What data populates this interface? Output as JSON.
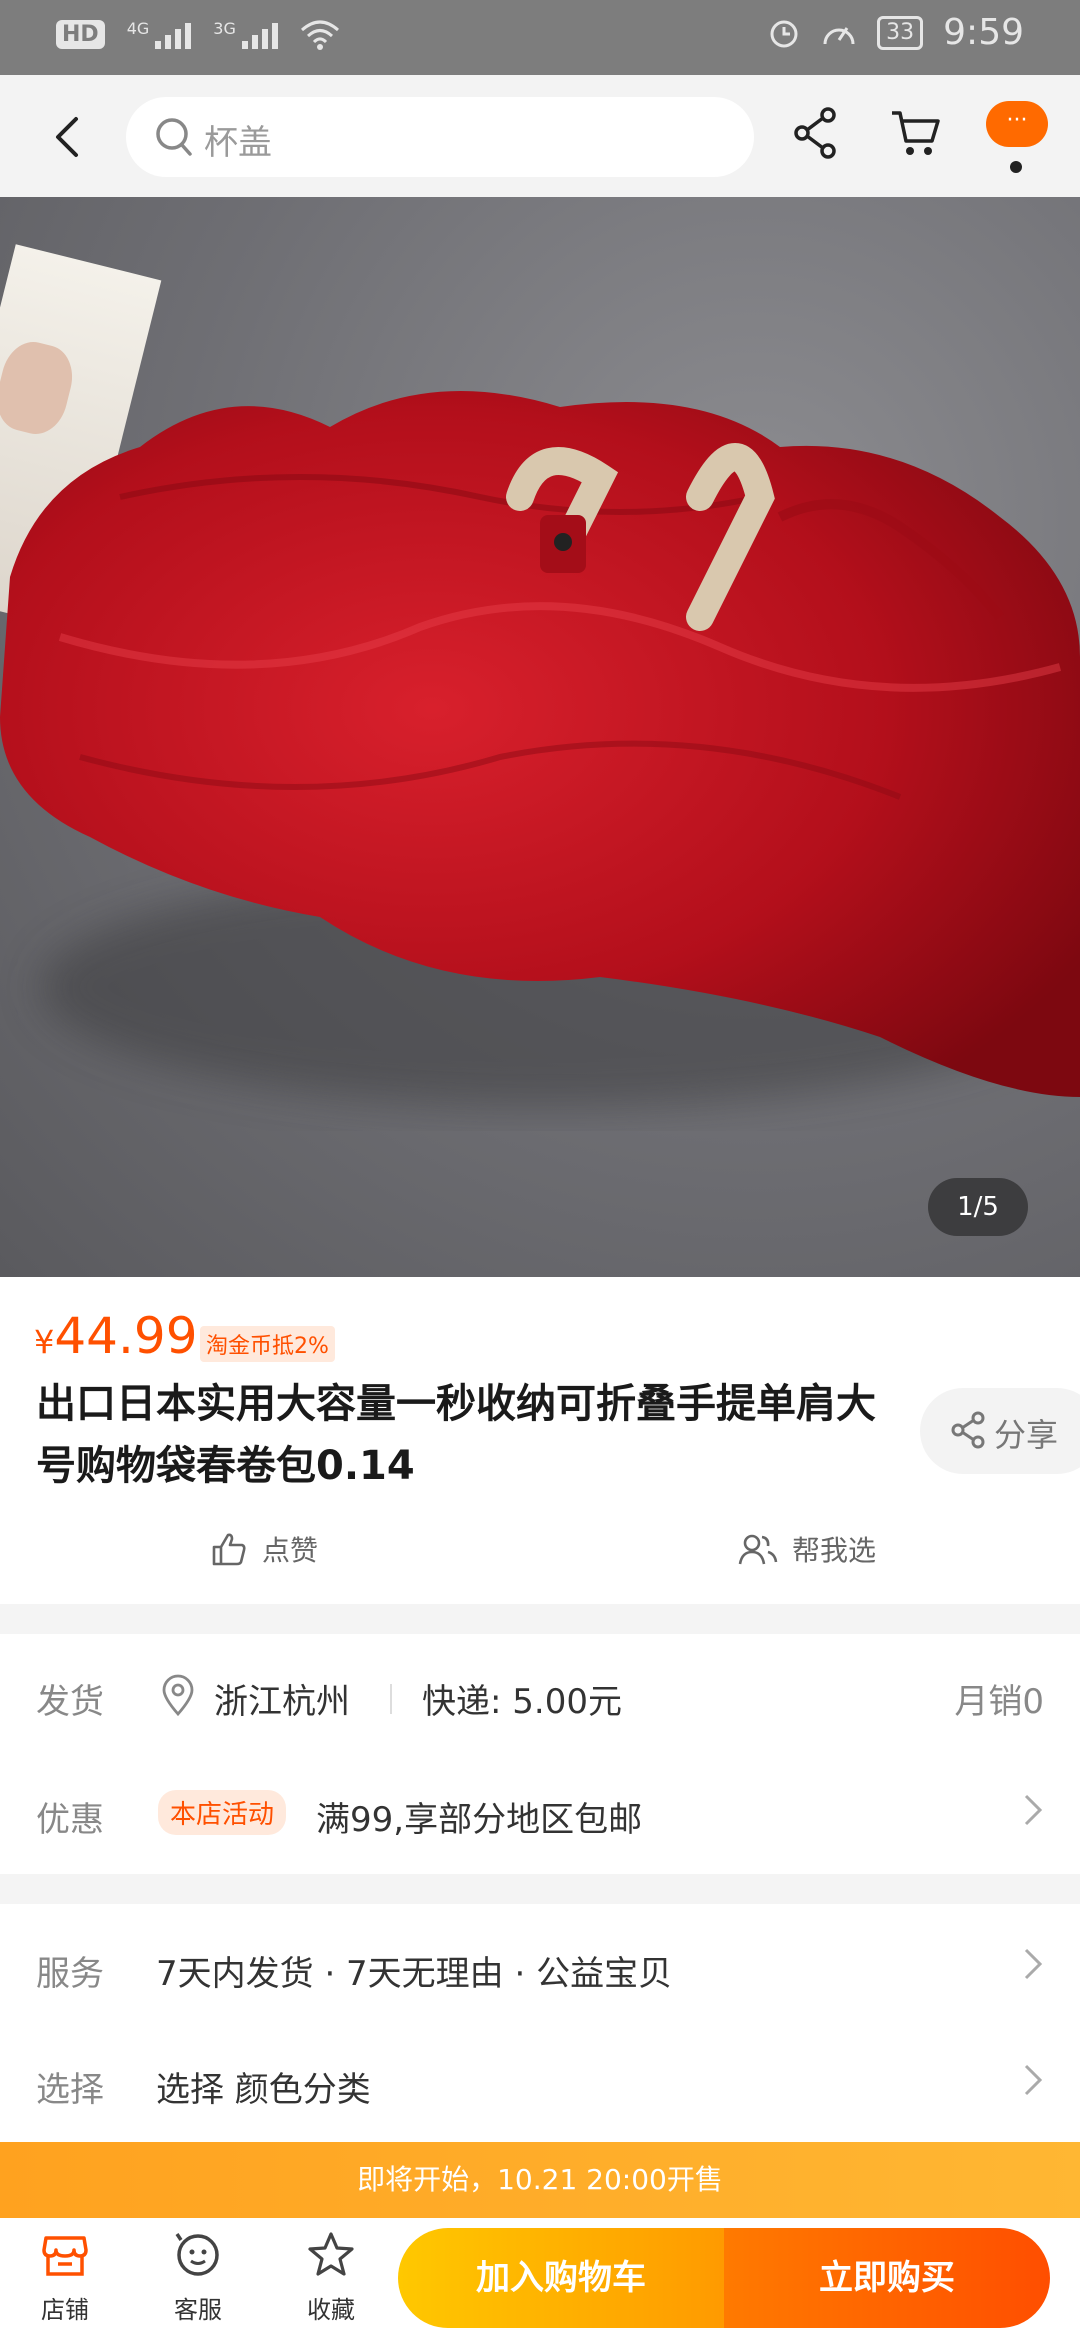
{
  "status_bar": {
    "hd": "HD",
    "sim1": "1",
    "net1": "4G",
    "net2": "3G",
    "battery": "33",
    "time": "9:59"
  },
  "header": {
    "search_placeholder": "杯盖",
    "more_label": "···"
  },
  "hero": {
    "counter": "1/5"
  },
  "product": {
    "currency": "¥",
    "price": "44.99",
    "coin_badge": "淘金币抵2%",
    "title": "出口日本实用大容量一秒收纳可折叠手提单肩大号购物袋春卷包0.14",
    "share_label": "分享",
    "like_label": "点赞",
    "help_pick_label": "帮我选"
  },
  "shipping": {
    "label": "发货",
    "location": "浙江杭州",
    "express": "快递: 5.00元",
    "monthly_sales": "月销0"
  },
  "promotion": {
    "label": "优惠",
    "tag": "本店活动",
    "text": "满99,享部分地区包邮"
  },
  "service": {
    "label": "服务",
    "text": "7天内发货 · 7天无理由 · 公益宝贝"
  },
  "selection": {
    "label": "选择",
    "text": "选择 颜色分类"
  },
  "banner": {
    "text": "即将开始，10.21 20:00开售"
  },
  "bottom_bar": {
    "store": "店铺",
    "customer_service": "客服",
    "favorite": "收藏",
    "add_to_cart": "加入购物车",
    "buy_now": "立即购买"
  },
  "colors": {
    "accent": "#ff5000",
    "bag_red": "#c8101c"
  }
}
